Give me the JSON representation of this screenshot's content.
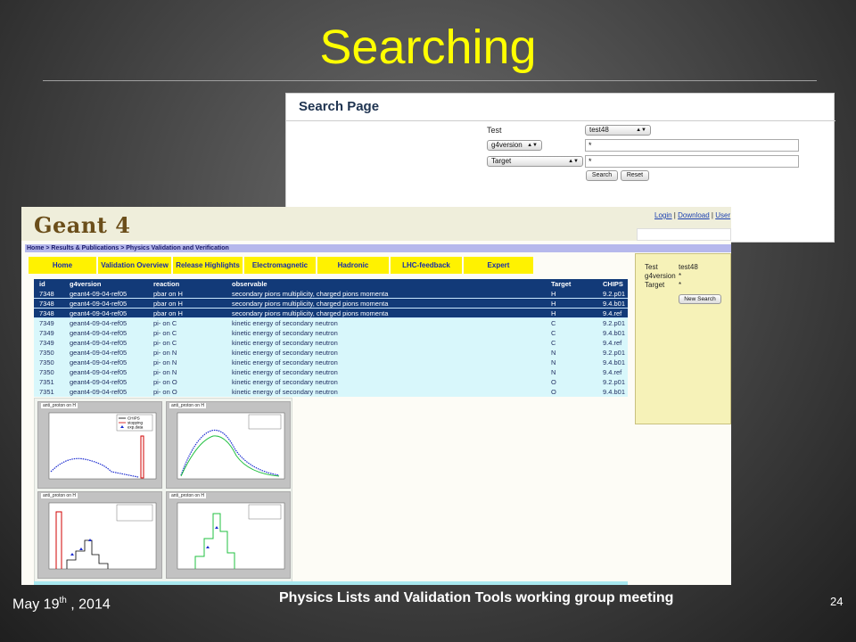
{
  "slide": {
    "title": "Searching",
    "footer_date": "May 19",
    "footer_date_sup": "th",
    "footer_date_year": " , 2014",
    "footer_meeting": "Physics Lists and Validation Tools working group meeting",
    "page_number": "24",
    "title_color": "#ffff00"
  },
  "search_page": {
    "heading": "Search Page",
    "test_label": "Test",
    "test_select": "test48",
    "field1_select": "g4version",
    "field1_value": "*",
    "field2_select": "Target",
    "field2_value": "*",
    "search_button": "Search",
    "reset_button": "Reset"
  },
  "geant_page": {
    "logo": "Geant 4",
    "top_links": {
      "login": "Login",
      "sep1": " | ",
      "download": "Download",
      "sep2": " | ",
      "user": "User"
    },
    "breadcrumb": "Home > Results & Publications > Physics Validation and Verification",
    "nav": [
      "Home",
      "Validation Overview",
      "Release Highlights",
      "Electromagnetic",
      "Hadronic",
      "LHC-feedback",
      "Expert"
    ],
    "table": {
      "headers": [
        "id",
        "g4version",
        "reaction",
        "observable",
        "Target",
        "CHIPS"
      ],
      "rows": [
        [
          "7348",
          "geant4-09-04-ref05",
          "pbar on H",
          "secondary pions multiplicity, charged pions momenta",
          "H",
          "9.2.p01"
        ],
        [
          "7348",
          "geant4-09-04-ref05",
          "pbar on H",
          "secondary pions multiplicity, charged pions momenta",
          "H",
          "9.4.b01"
        ],
        [
          "7348",
          "geant4-09-04-ref05",
          "pbar on H",
          "secondary pions multiplicity, charged pions momenta",
          "H",
          "9.4.ref"
        ],
        [
          "7349",
          "geant4-09-04-ref05",
          "pi- on C",
          "kinetic energy of secondary neutron",
          "C",
          "9.2.p01"
        ],
        [
          "7349",
          "geant4-09-04-ref05",
          "pi- on C",
          "kinetic energy of secondary neutron",
          "C",
          "9.4.b01"
        ],
        [
          "7349",
          "geant4-09-04-ref05",
          "pi- on C",
          "kinetic energy of secondary neutron",
          "C",
          "9.4.ref"
        ],
        [
          "7350",
          "geant4-09-04-ref05",
          "pi- on N",
          "kinetic energy of secondary neutron",
          "N",
          "9.2.p01"
        ],
        [
          "7350",
          "geant4-09-04-ref05",
          "pi- on N",
          "kinetic energy of secondary neutron",
          "N",
          "9.4.b01"
        ],
        [
          "7350",
          "geant4-09-04-ref05",
          "pi- on N",
          "kinetic energy of secondary neutron",
          "N",
          "9.4.ref"
        ],
        [
          "7351",
          "geant4-09-04-ref05",
          "pi- on O",
          "kinetic energy of secondary neutron",
          "O",
          "9.2.p01"
        ],
        [
          "7351",
          "geant4-09-04-ref05",
          "pi- on O",
          "kinetic energy of secondary neutron",
          "O",
          "9.4.b01"
        ]
      ]
    },
    "sidebox": {
      "test_label": "Test",
      "test_value": "test48",
      "g4version_label": "g4version",
      "g4version_value": "*",
      "target_label": "Target",
      "target_value": "*",
      "new_search_button": "New Search"
    },
    "plots": {
      "titles": [
        "anti_proton on H",
        "anti_proton on H",
        "anti_proton on H",
        "anti_proton on H"
      ],
      "legend_left": [
        "CHIPS",
        "stopping",
        "exp.data"
      ]
    }
  }
}
